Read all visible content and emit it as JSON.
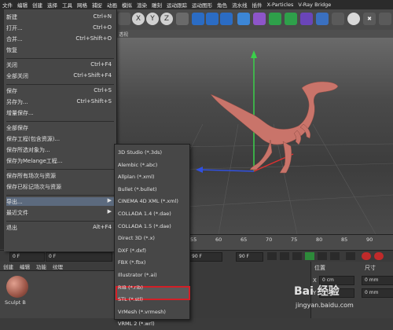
{
  "menubar": [
    "文件",
    "编辑",
    "创建",
    "选择",
    "工具",
    "网格",
    "捕捉",
    "动画",
    "模拟",
    "渲染",
    "雕刻",
    "运动跟踪",
    "运动图形",
    "角色",
    "流水线",
    "插件",
    "X-Particles",
    "V-Ray Bridge"
  ],
  "viewport": {
    "title": "透视"
  },
  "file_menu": {
    "items": [
      {
        "label": "新建",
        "shortcut": "Ctrl+N"
      },
      {
        "label": "打开...",
        "shortcut": "Ctrl+O"
      },
      {
        "label": "合并...",
        "shortcut": "Ctrl+Shift+O"
      },
      {
        "label": "恢复",
        "shortcut": ""
      },
      {
        "label": "关闭",
        "shortcut": "Ctrl+F4"
      },
      {
        "label": "全部关闭",
        "shortcut": "Ctrl+Shift+F4"
      },
      {
        "label": "保存",
        "shortcut": "Ctrl+S"
      },
      {
        "label": "另存为...",
        "shortcut": "Ctrl+Shift+S"
      },
      {
        "label": "增量保存...",
        "shortcut": ""
      },
      {
        "label": "全部保存",
        "shortcut": ""
      },
      {
        "label": "保存工程(包含资源)...",
        "shortcut": ""
      },
      {
        "label": "保存所选对象为...",
        "shortcut": ""
      },
      {
        "label": "保存为Melange工程...",
        "shortcut": ""
      },
      {
        "label": "保存所有场次与资源",
        "shortcut": ""
      },
      {
        "label": "保存已标记场次与资源",
        "shortcut": ""
      },
      {
        "label": "导出...",
        "shortcut": ""
      },
      {
        "label": "最近文件",
        "shortcut": ""
      },
      {
        "label": "退出",
        "shortcut": "Alt+F4"
      }
    ]
  },
  "export_submenu": {
    "items": [
      "3D Studio (*.3ds)",
      "Alembic (*.abc)",
      "Allplan (*.xml)",
      "Bullet (*.bullet)",
      "CINEMA 4D XML (*.xml)",
      "COLLADA 1.4 (*.dae)",
      "COLLADA 1.5 (*.dae)",
      "Direct 3D (*.x)",
      "DXF (*.dxf)",
      "FBX (*.fbx)",
      "Illustrator (*.ai)",
      "RIB (*.rib)",
      "STL (*.stl)",
      "VrMesh (*.vrmesh)",
      "VRML 2 (*.wrl)"
    ],
    "highlighted": "STL (*.stl)"
  },
  "timeline": {
    "ticks": [
      "55",
      "60",
      "65",
      "70",
      "75",
      "80",
      "85",
      "90"
    ]
  },
  "transport": {
    "start_frame": "0 F",
    "current_frame": "0 F",
    "end_frame": "90 F",
    "end_frame2": "90 F"
  },
  "material_manager": {
    "menu": [
      "创建",
      "编辑",
      "功能",
      "纹理"
    ],
    "material_name": "Sculpt B"
  },
  "coordinates": {
    "position_label": "位置",
    "size_label": "尺寸",
    "x_label": "X",
    "y_label": "Y",
    "x_value": "0 cm",
    "y_value": "0 cm",
    "x_size": "0 mm",
    "y_size": "0 mm"
  },
  "watermark": {
    "text": "Bai 经验",
    "url": "jingyan.baidu.com"
  },
  "colors": {
    "highlight_box": "#d21f27",
    "model": "#c9746a",
    "axis_y": "#3ad04a",
    "axis_x": "#e03030",
    "axis_z": "#3050e0"
  }
}
